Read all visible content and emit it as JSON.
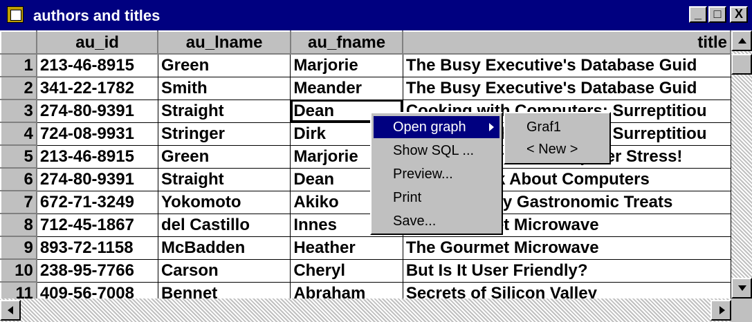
{
  "window": {
    "title": "authors and titles",
    "minimize": "_",
    "maximize": "□",
    "close": "X"
  },
  "columns": [
    "au_id",
    "au_lname",
    "au_fname",
    "title"
  ],
  "rows": [
    {
      "n": "1",
      "au_id": "213-46-8915",
      "au_lname": "Green",
      "au_fname": "Marjorie",
      "title": "The Busy Executive's Database Guid"
    },
    {
      "n": "2",
      "au_id": "341-22-1782",
      "au_lname": "Smith",
      "au_fname": "Meander",
      "title": "The Busy Executive's Database Guid"
    },
    {
      "n": "3",
      "au_id": "274-80-9391",
      "au_lname": "Straight",
      "au_fname": "Dean",
      "title": "Cooking with Computers: Surreptitiou"
    },
    {
      "n": "4",
      "au_id": "724-08-9931",
      "au_lname": "Stringer",
      "au_fname": "Dirk",
      "title": "Cooking with Computers: Surreptitiou"
    },
    {
      "n": "5",
      "au_id": "213-46-8915",
      "au_lname": "Green",
      "au_fname": "Marjorie",
      "title": "You Can Combat Computer Stress!"
    },
    {
      "n": "6",
      "au_id": "274-80-9391",
      "au_lname": "Straight",
      "au_fname": "Dean",
      "title": "Straight Talk About Computers"
    },
    {
      "n": "7",
      "au_id": "672-71-3249",
      "au_lname": "Yokomoto",
      "au_fname": "Akiko",
      "title": "Silicon Valley Gastronomic Treats"
    },
    {
      "n": "8",
      "au_id": "712-45-1867",
      "au_lname": "del Castillo",
      "au_fname": "Innes",
      "title": "The Gourmet Microwave"
    },
    {
      "n": "9",
      "au_id": "893-72-1158",
      "au_lname": "McBadden",
      "au_fname": "Heather",
      "title": "The Gourmet Microwave"
    },
    {
      "n": "10",
      "au_id": "238-95-7766",
      "au_lname": "Carson",
      "au_fname": "Cheryl",
      "title": "But Is It User Friendly?"
    },
    {
      "n": "11",
      "au_id": "409-56-7008",
      "au_lname": "Bennet",
      "au_fname": "Abraham",
      "title": "Secrets of Silicon Valley"
    }
  ],
  "context_menu": {
    "items": [
      "Open graph",
      "Show SQL ...",
      "Preview...",
      "Print",
      "Save..."
    ]
  },
  "submenu": {
    "items": [
      "Graf1",
      "< New >"
    ]
  }
}
